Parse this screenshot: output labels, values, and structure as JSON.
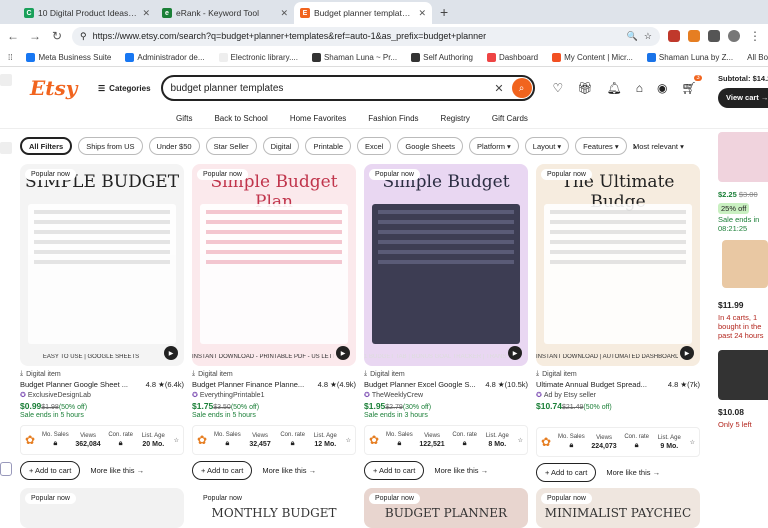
{
  "browser": {
    "tabs": [
      {
        "title": "10 Digital Product Ideas that s...",
        "color": "#19a05a",
        "glyph": "C"
      },
      {
        "title": "eRank - Keyword Tool",
        "color": "#1a7f37",
        "glyph": "e"
      },
      {
        "title": "Budget planner templates - E...",
        "color": "#f1641e",
        "glyph": "E"
      }
    ],
    "url": "https://www.etsy.com/search?q=budget+planner+templates&ref=auto-1&as_prefix=budget+planner",
    "bookmarks": [
      "Meta Business Suite",
      "Administrador de...",
      "Electronic library....",
      "Shaman Luna ~ Pr...",
      "Self Authoring",
      "Dashboard",
      "My Content | Micr...",
      "Shaman Luna by Z..."
    ],
    "all_bookmarks": "All Bookm"
  },
  "etsy": {
    "logo": "Etsy",
    "categories": "Categories",
    "search_value": "budget planner templates",
    "cart_count": "3",
    "subnav": [
      "Gifts",
      "Back to School",
      "Home Favorites",
      "Fashion Finds",
      "Registry",
      "Gift Cards"
    ],
    "filters": [
      "All Filters",
      "Ships from US",
      "Under $50",
      "Star Seller",
      "Digital",
      "Printable",
      "Excel",
      "Google Sheets",
      "Platform ▾",
      "Layout ▾",
      "Features ▾"
    ],
    "sort": "Most relevant ▾"
  },
  "products": [
    {
      "badge": "Popular now",
      "thumb_title": "SIMPLE BUDGET",
      "banner": "EASY TO USE | GOOGLE SHEETS",
      "type": "Digital item",
      "title": "Budget Planner Google Sheet ...",
      "rating": "4.8 ★",
      "reviews": "(6.4k)",
      "shop": "ExclusiveDesignLab",
      "price": "$0.99",
      "orig": "$1.98",
      "off": "(50% off)",
      "sale": "Sale ends in 5 hours",
      "mo_sales": "",
      "views": "362,084",
      "con_rate": "",
      "list_age": "20 Mo.",
      "bg": "#f4f4f4",
      "accent": "#222"
    },
    {
      "badge": "Popular now",
      "thumb_title": "Simple Budget Plan",
      "banner": "INSTANT DOWNLOAD - PRINTABLE PDF - US LETTER",
      "type": "Digital item",
      "title": "Budget Planner Finance Planne...",
      "rating": "4.8 ★",
      "reviews": "(4.9k)",
      "shop": "EverythingPrintable1",
      "price": "$1.75",
      "orig": "$3.50",
      "off": "(50% off)",
      "sale": "Sale ends in 5 hours",
      "mo_sales": "",
      "views": "32,457",
      "con_rate": "",
      "list_age": "12 Mo.",
      "bg": "#fbe9ec",
      "accent": "#c0344b"
    },
    {
      "badge": "Popular now",
      "thumb_title": "Simple Budget",
      "banner": "1 BUDGET TAB | BONUS GOAL TRACKER | TRANSACTIONS",
      "type": "Digital item",
      "title": "Budget Planner Excel Google S...",
      "rating": "4.8 ★",
      "reviews": "(10.5k)",
      "shop": "TheWeeklyCrew",
      "price": "$1.95",
      "orig": "$2.79",
      "off": "(30% off)",
      "sale": "Sale ends in 3 hours",
      "mo_sales": "",
      "views": "122,521",
      "con_rate": "",
      "list_age": "8 Mo.",
      "bg": "#e9d7f2",
      "accent": "#2b2d42"
    },
    {
      "badge": "Popular now",
      "thumb_title": "The Ultimate Budge",
      "banner": "INSTANT DOWNLOAD | AUTOMATED DASHBOARD | GLOBAL",
      "type": "Digital item",
      "title": "Ultimate Annual Budget Spread...",
      "rating": "4.8 ★",
      "reviews": "(7k)",
      "shop": "Ad by Etsy seller",
      "price": "$10.74",
      "orig": "$21.49",
      "off": "(50% off)",
      "sale": "",
      "mo_sales": "",
      "views": "224,073",
      "con_rate": "",
      "list_age": "9 Mo.",
      "bg": "#f6ecdf",
      "accent": "#222"
    }
  ],
  "erank_labels": {
    "mo_sales": "Mo. Sales",
    "views": "Views",
    "con_rate": "Con. rate",
    "list_age": "List. Age"
  },
  "buttons": {
    "add": "+ Add to cart",
    "more": "More like this →"
  },
  "row2": [
    "Popular now",
    "Popular now",
    "Popular now",
    "Popular now"
  ],
  "row2_titles": [
    "",
    "MONTHLY BUDGET",
    "BUDGET PLANNER",
    "MINIMALIST PAYCHEC"
  ],
  "sidebar": {
    "subtotal": "Subtotal: $14.2",
    "view_cart": "View cart →",
    "price1": "$2.25",
    "orig1": "$3.00",
    "off1": "25% off",
    "sale1": "Sale ends in 08:21:25",
    "price2": "$11.99",
    "note2": "In 4 carts, 1 bought in the past 24 hours",
    "price3": "$10.08",
    "note3": "Only 5 left"
  }
}
